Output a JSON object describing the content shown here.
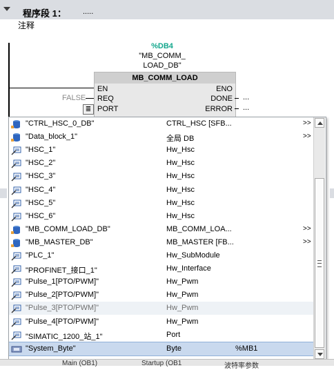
{
  "segment": {
    "title": "程序段 1：",
    "dots": "....."
  },
  "comment": "注释",
  "block": {
    "instance_name": "%DB4",
    "instance_q1": "\"MB_COMM_",
    "instance_q2": "LOAD_DB\"",
    "title": "MB_COMM_LOAD",
    "pins_in": [
      "EN",
      "REQ",
      "PORT"
    ],
    "pins_out": [
      "ENO",
      "DONE",
      "ERROR"
    ],
    "req_value": "FALSE",
    "out_dots": "...",
    "port_browse_icon": "list-icon"
  },
  "colors": {
    "accent": "#14a78d",
    "selection": "#c9d9ee",
    "header": "#dadde2"
  },
  "list": {
    "rows": [
      {
        "name": "\"CTRL_HSC_0_DB\"",
        "type": "CTRL_HSC [SFB...",
        "address": "",
        "expand": ">>",
        "icon": "db-icon",
        "state": ""
      },
      {
        "name": "\"Data_block_1\"",
        "type": "全局 DB",
        "address": "",
        "expand": ">>",
        "icon": "db-icon",
        "state": ""
      },
      {
        "name": "\"HSC_1\"",
        "type": "Hw_Hsc",
        "address": "",
        "expand": "",
        "icon": "hw-tag-icon",
        "state": ""
      },
      {
        "name": "\"HSC_2\"",
        "type": "Hw_Hsc",
        "address": "",
        "expand": "",
        "icon": "hw-tag-icon",
        "state": ""
      },
      {
        "name": "\"HSC_3\"",
        "type": "Hw_Hsc",
        "address": "",
        "expand": "",
        "icon": "hw-tag-icon",
        "state": ""
      },
      {
        "name": "\"HSC_4\"",
        "type": "Hw_Hsc",
        "address": "",
        "expand": "",
        "icon": "hw-tag-icon",
        "state": ""
      },
      {
        "name": "\"HSC_5\"",
        "type": "Hw_Hsc",
        "address": "",
        "expand": "",
        "icon": "hw-tag-icon",
        "state": ""
      },
      {
        "name": "\"HSC_6\"",
        "type": "Hw_Hsc",
        "address": "",
        "expand": "",
        "icon": "hw-tag-icon",
        "state": ""
      },
      {
        "name": "\"MB_COMM_LOAD_DB\"",
        "type": "MB_COMM_LOA...",
        "address": "",
        "expand": ">>",
        "icon": "db-icon",
        "state": ""
      },
      {
        "name": "\"MB_MASTER_DB\"",
        "type": "MB_MASTER [FB...",
        "address": "",
        "expand": ">>",
        "icon": "db-icon",
        "state": ""
      },
      {
        "name": "\"PLC_1\"",
        "type": "Hw_SubModule",
        "address": "",
        "expand": "",
        "icon": "hw-tag-icon",
        "state": ""
      },
      {
        "name": "\"PROFINET_接口_1\"",
        "type": "Hw_Interface",
        "address": "",
        "expand": "",
        "icon": "hw-tag-icon",
        "state": ""
      },
      {
        "name": "\"Pulse_1[PTO/PWM]\"",
        "type": "Hw_Pwm",
        "address": "",
        "expand": "",
        "icon": "hw-tag-icon",
        "state": ""
      },
      {
        "name": "\"Pulse_2[PTO/PWM]\"",
        "type": "Hw_Pwm",
        "address": "",
        "expand": "",
        "icon": "hw-tag-icon",
        "state": ""
      },
      {
        "name": "\"Pulse_3[PTO/PWM]\"",
        "type": "Hw_Pwm",
        "address": "",
        "expand": "",
        "icon": "hw-tag-icon",
        "state": "hover"
      },
      {
        "name": "\"Pulse_4[PTO/PWM]\"",
        "type": "Hw_Pwm",
        "address": "",
        "expand": "",
        "icon": "hw-tag-icon",
        "state": ""
      },
      {
        "name": "\"SIMATIC_1200_站_1\"",
        "type": "Port",
        "address": "",
        "expand": "",
        "icon": "hw-tag-icon",
        "state": ""
      },
      {
        "name": "\"System_Byte\"",
        "type": "Byte",
        "address": "%MB1",
        "expand": "",
        "icon": "plc-tag-icon",
        "state": "selected"
      }
    ]
  },
  "bottom_tabs": [
    "Main (OB1)",
    "Startup (OB1",
    "波特率参数"
  ]
}
